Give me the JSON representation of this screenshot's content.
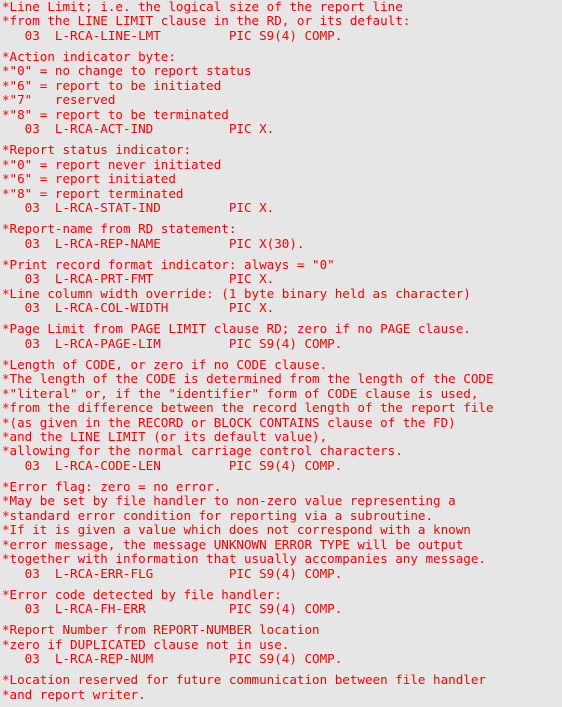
{
  "document": {
    "text_color": "#ff0000",
    "background_color": "#e6e6e6",
    "groups": [
      {
        "lines": [
          "*Line Limit; i.e. the logical size of the report line",
          "*from the LINE LIMIT clause in the RD, or its default:",
          "   03  L-RCA-LINE-LMT         PIC S9(4) COMP."
        ]
      },
      {
        "lines": [
          "*Action indicator byte:",
          "*\"0\" = no change to report status",
          "*\"6\" = report to be initiated",
          "*\"7\"   reserved",
          "*\"8\" = report to be terminated",
          "   03  L-RCA-ACT-IND          PIC X."
        ]
      },
      {
        "lines": [
          "*Report status indicator:",
          "*\"0\" = report never initiated",
          "*\"6\" = report initiated",
          "*\"8\" = report terminated",
          "   03  L-RCA-STAT-IND         PIC X."
        ]
      },
      {
        "lines": [
          "*Report-name from RD statement:",
          "   03  L-RCA-REP-NAME         PIC X(30)."
        ]
      },
      {
        "tight": true,
        "lines": [
          "*Print record format indicator: always = \"0\"",
          "   03  L-RCA-PRT-FMT          PIC X."
        ]
      },
      {
        "lines": [
          "*Line column width override: (1 byte binary held as character)",
          "   03  L-RCA-COL-WIDTH        PIC X."
        ]
      },
      {
        "lines": [
          "*Page Limit from PAGE LIMIT clause RD; zero if no PAGE clause.",
          "   03  L-RCA-PAGE-LIM         PIC S9(4) COMP."
        ]
      },
      {
        "lines": [
          "*Length of CODE, or zero if no CODE clause.",
          "*The length of the CODE is determined from the length of the CODE",
          "*\"literal\" or, if the \"identifier\" form of CODE clause is used,",
          "*from the difference between the record length of the report file",
          "*(as given in the RECORD or BLOCK CONTAINS clause of the FD)",
          "*and the LINE LIMIT (or its default value),",
          "*allowing for the normal carriage control characters.",
          "   03  L-RCA-CODE-LEN         PIC S9(4) COMP."
        ]
      },
      {
        "lines": [
          "*Error flag: zero = no error.",
          "*May be set by file handler to non-zero value representing a",
          "*standard error condition for reporting via a subroutine.",
          "*If it is given a value which does not correspond with a known",
          "*error message, the message UNKNOWN ERROR TYPE will be output",
          "*together with information that usually accompanies any message.",
          "   03  L-RCA-ERR-FLG          PIC S9(4) COMP."
        ]
      },
      {
        "lines": [
          "*Error code detected by file handler:",
          "   03  L-RCA-FH-ERR           PIC S9(4) COMP."
        ]
      },
      {
        "lines": [
          "*Report Number from REPORT-NUMBER location",
          "*zero if DUPLICATED clause not in use.",
          "   03  L-RCA-REP-NUM          PIC S9(4) COMP."
        ]
      },
      {
        "lines": [
          "*Location reserved for future communication between file handler",
          "*and report writer."
        ]
      }
    ]
  }
}
